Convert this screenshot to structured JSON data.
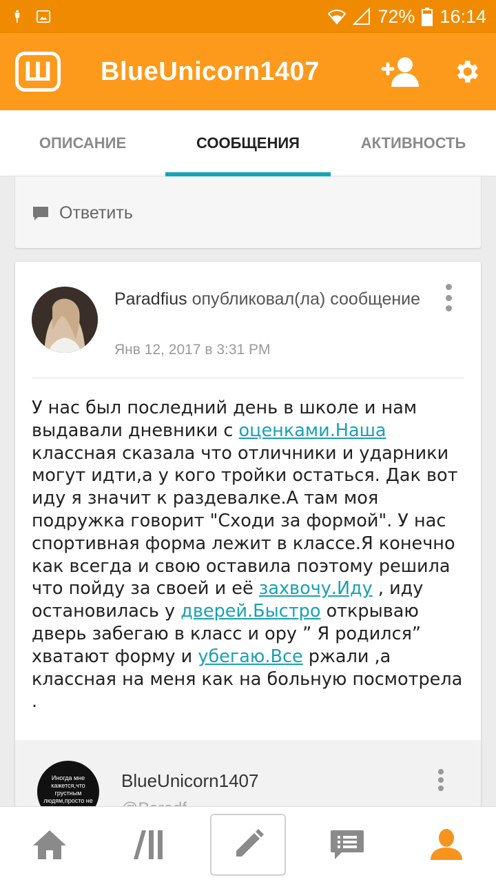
{
  "status_bar": {
    "battery": "72%",
    "time": "16:14"
  },
  "app_bar": {
    "logo_letter": "Ш",
    "title": "BlueUnicorn1407"
  },
  "tabs": [
    {
      "label": "ОПИСАНИЕ",
      "active": false
    },
    {
      "label": "СООБЩЕНИЯ",
      "active": true
    },
    {
      "label": "АКТИВНОСТЬ",
      "active": false
    }
  ],
  "previous_card": {
    "reply_label": "Ответить"
  },
  "post": {
    "author": "Paradfius",
    "action": "опубликовал(ла) сообщение",
    "date": "Янв 12, 2017 в 3:31 PM",
    "body": {
      "p1": "У нас был последний день  в школе и нам выдавали дневники с ",
      "l1": "оценками.Наша",
      "p2": " классная сказала что отличники и ударники могут идти,а у кого тройки остаться. Дак вот иду я значит к раздевалке.А там моя подружка говорит \"Сходи за формой\". У нас спортивная форма лежит в классе.Я конечно как всегда и свою оставила поэтому решила что пойду за своей и её ",
      "l2": "захвочу.Иду",
      "p3": " , иду остановилась  у ",
      "l3": "дверей.Быстро",
      "p4": " открываю дверь забегаю в класс и ору ” Я родился” хватают форму и ",
      "l4": "убегаю.Все",
      "p5": " ржали ,а классная на меня  как  на больную посмотрела ."
    }
  },
  "reply": {
    "avatar_text": "Иногда мне кажется,что грустным людям,просто не",
    "name": "BlueUnicorn1407",
    "subtext": "@Paradf"
  },
  "colors": {
    "status_bar": "#f08a00",
    "app_bar": "#fd9a1c",
    "tab_indicator": "#16a5b8",
    "link": "#1aa0b3",
    "accent_nav": "#f7941d"
  },
  "bottom_nav": [
    "home-icon",
    "catalog-icon",
    "pencil-icon",
    "chat-icon",
    "profile-icon"
  ]
}
